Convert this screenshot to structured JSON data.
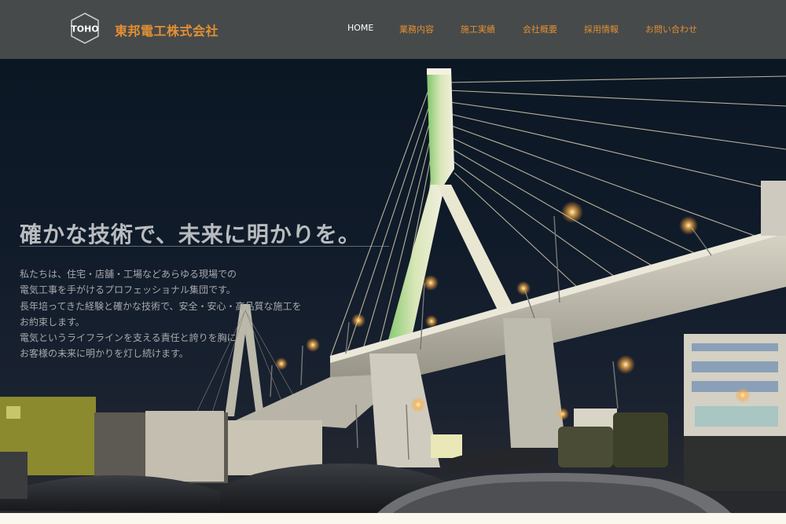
{
  "header": {
    "logo_text": "TOHO",
    "company_name": "東邦電工株式会社"
  },
  "nav": {
    "items": [
      {
        "label": "HOME",
        "active": true
      },
      {
        "label": "業務内容",
        "active": false
      },
      {
        "label": "施工実績",
        "active": false
      },
      {
        "label": "会社概要",
        "active": false
      },
      {
        "label": "採用情報",
        "active": false
      },
      {
        "label": "お問い合わせ",
        "active": false
      }
    ]
  },
  "hero": {
    "headline": "確かな技術で、未来に明かりを。",
    "body_lines": [
      "私たちは、住宅・店舗・工場などあらゆる現場での",
      "電気工事を手がけるプロフェッショナル集団です。",
      "長年培ってきた経験と確かな技術で、安全・安心・高品質な施工を",
      "お約束します。",
      "電気というライフラインを支える責任と誇りを胸に",
      "お客様の未来に明かりを灯し続けます。"
    ],
    "background_image": "night-cable-stayed-bridge-photo"
  },
  "colors": {
    "header_bg": "#464a4a",
    "accent": "#e48f33",
    "nav_active": "#ffffff",
    "headline": "#b9bcbe",
    "body_text": "#a7a9ab"
  }
}
